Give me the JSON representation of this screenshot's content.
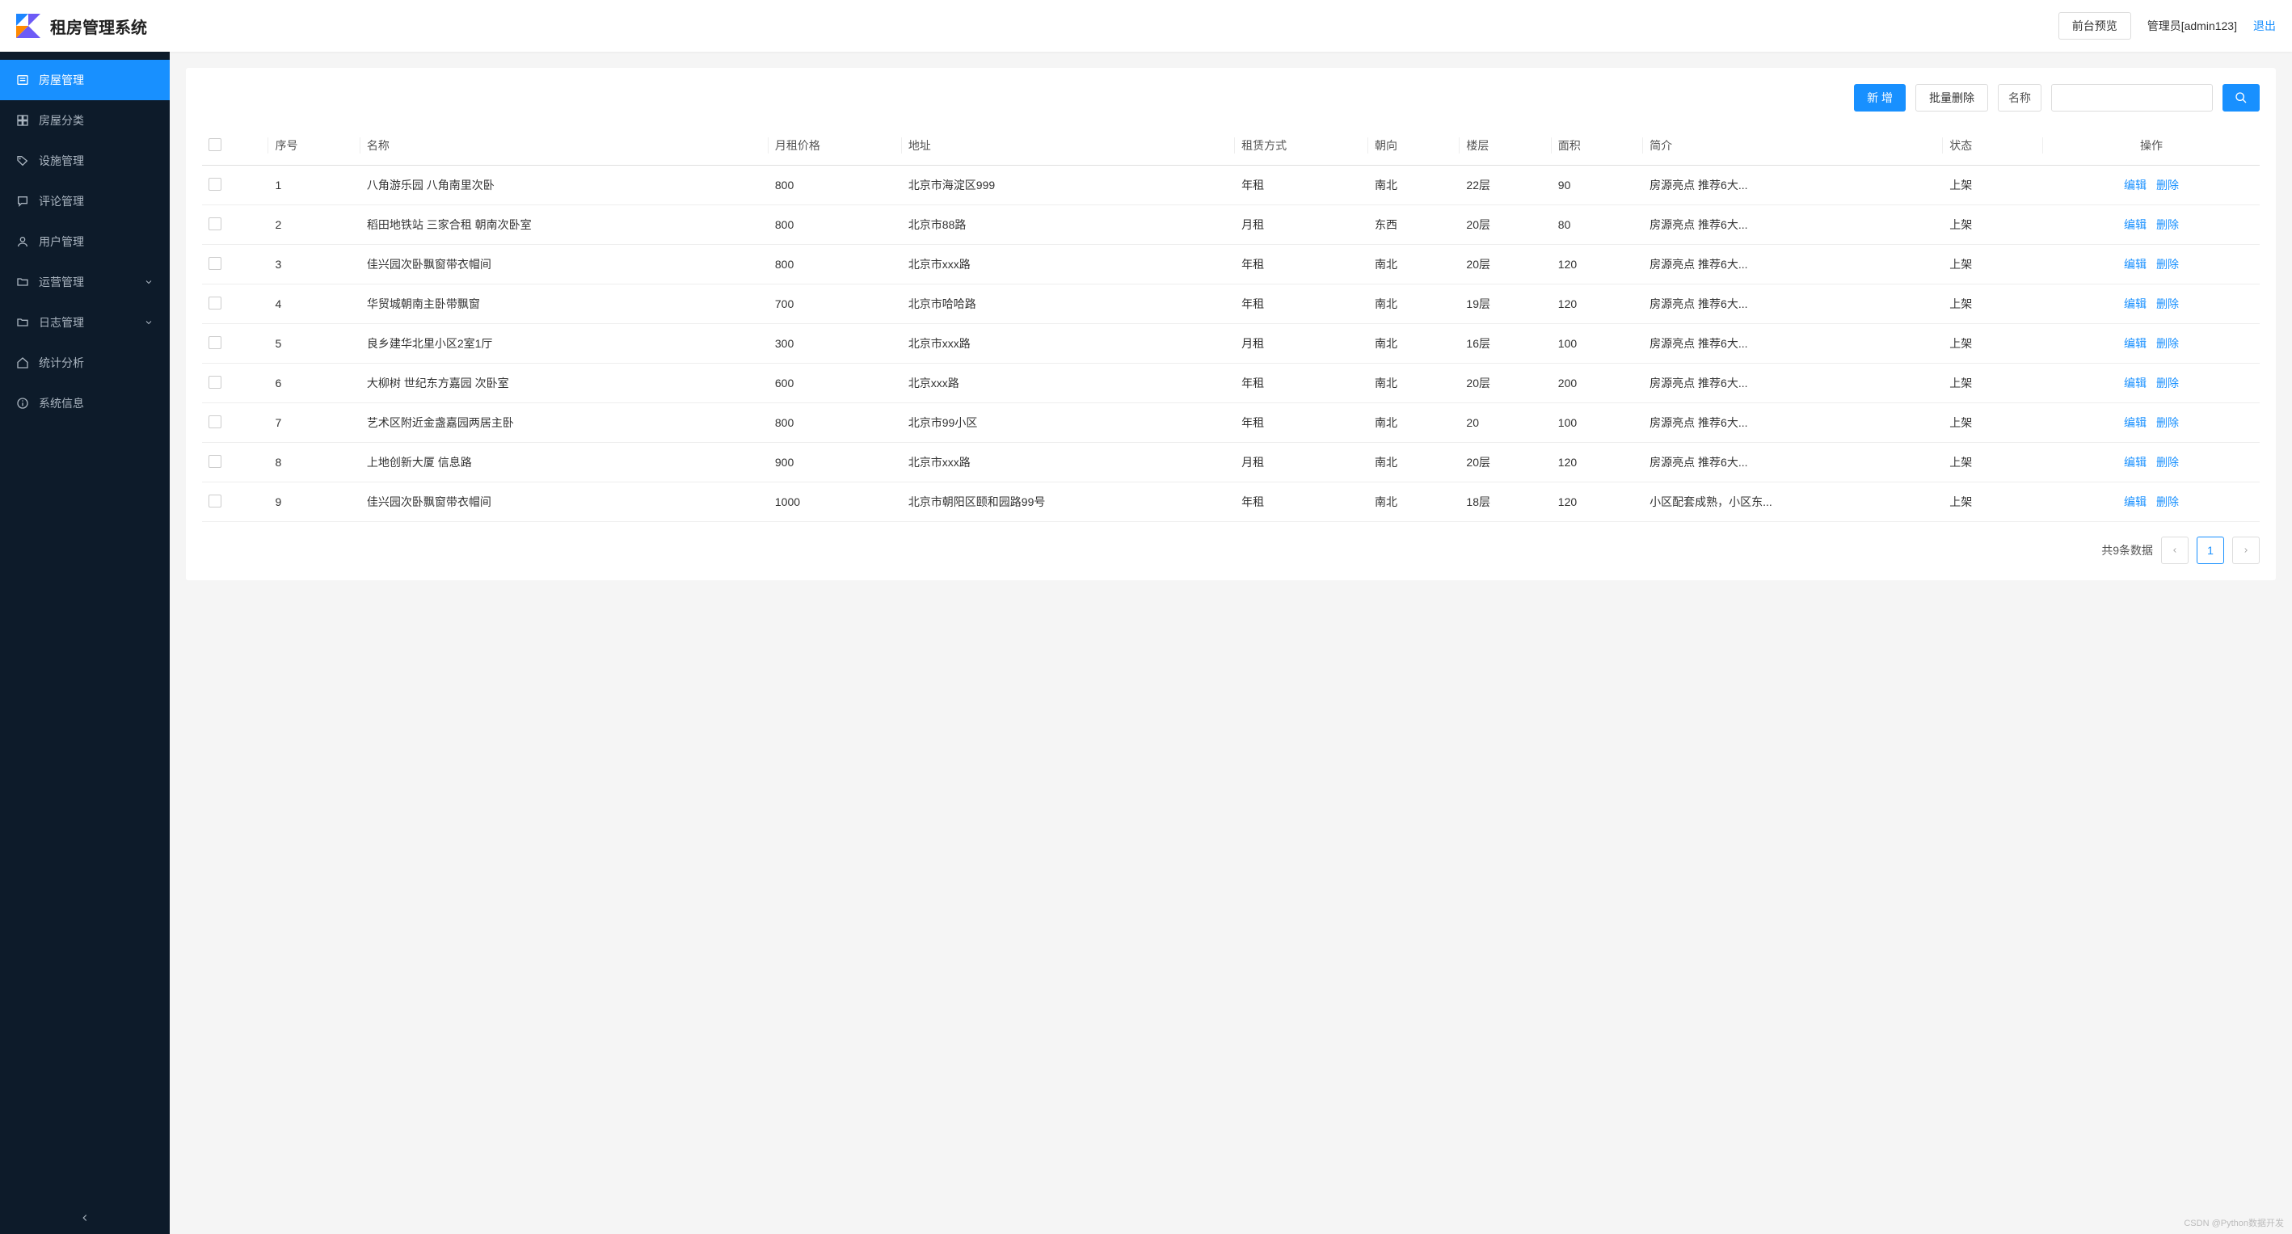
{
  "header": {
    "title": "租房管理系统",
    "preview_btn": "前台预览",
    "user_label": "管理员[admin123]",
    "logout_label": "退出"
  },
  "sidebar": {
    "items": [
      {
        "label": "房屋管理",
        "icon": "list",
        "active": true
      },
      {
        "label": "房屋分类",
        "icon": "grid"
      },
      {
        "label": "设施管理",
        "icon": "tag"
      },
      {
        "label": "评论管理",
        "icon": "chat"
      },
      {
        "label": "用户管理",
        "icon": "user"
      },
      {
        "label": "运营管理",
        "icon": "folder",
        "expandable": true
      },
      {
        "label": "日志管理",
        "icon": "folder",
        "expandable": true
      },
      {
        "label": "统计分析",
        "icon": "home"
      },
      {
        "label": "系统信息",
        "icon": "info"
      }
    ]
  },
  "toolbar": {
    "new_btn": "新 增",
    "batch_delete_btn": "批量删除",
    "search_field_label": "名称",
    "search_placeholder": ""
  },
  "table": {
    "columns": {
      "no": "序号",
      "name": "名称",
      "price": "月租价格",
      "addr": "地址",
      "rent": "租赁方式",
      "dir": "朝向",
      "floor": "楼层",
      "area": "面积",
      "intro": "简介",
      "status": "状态",
      "ops": "操作"
    },
    "ops": {
      "edit": "编辑",
      "delete": "删除"
    },
    "rows": [
      {
        "no": "1",
        "name": "八角游乐园 八角南里次卧",
        "price": "800",
        "addr": "北京市海淀区999",
        "rent": "年租",
        "dir": "南北",
        "floor": "22层",
        "area": "90",
        "intro": "房源亮点 推荐6大...",
        "status": "上架"
      },
      {
        "no": "2",
        "name": "稻田地铁站 三家合租 朝南次卧室",
        "price": "800",
        "addr": "北京市88路",
        "rent": "月租",
        "dir": "东西",
        "floor": "20层",
        "area": "80",
        "intro": "房源亮点 推荐6大...",
        "status": "上架"
      },
      {
        "no": "3",
        "name": "佳兴园次卧飘窗带衣帽间",
        "price": "800",
        "addr": "北京市xxx路",
        "rent": "年租",
        "dir": "南北",
        "floor": "20层",
        "area": "120",
        "intro": "房源亮点 推荐6大...",
        "status": "上架"
      },
      {
        "no": "4",
        "name": "华贸城朝南主卧带飘窗",
        "price": "700",
        "addr": "北京市哈哈路",
        "rent": "年租",
        "dir": "南北",
        "floor": "19层",
        "area": "120",
        "intro": "房源亮点 推荐6大...",
        "status": "上架"
      },
      {
        "no": "5",
        "name": "良乡建华北里小区2室1厅",
        "price": "300",
        "addr": "北京市xxx路",
        "rent": "月租",
        "dir": "南北",
        "floor": "16层",
        "area": "100",
        "intro": "房源亮点 推荐6大...",
        "status": "上架"
      },
      {
        "no": "6",
        "name": "大柳树 世纪东方嘉园 次卧室",
        "price": "600",
        "addr": "北京xxx路",
        "rent": "年租",
        "dir": "南北",
        "floor": "20层",
        "area": "200",
        "intro": "房源亮点 推荐6大...",
        "status": "上架"
      },
      {
        "no": "7",
        "name": "艺术区附近金盏嘉园两居主卧",
        "price": "800",
        "addr": "北京市99小区",
        "rent": "年租",
        "dir": "南北",
        "floor": "20",
        "area": "100",
        "intro": "房源亮点 推荐6大...",
        "status": "上架"
      },
      {
        "no": "8",
        "name": "上地创新大厦 信息路",
        "price": "900",
        "addr": "北京市xxx路",
        "rent": "月租",
        "dir": "南北",
        "floor": "20层",
        "area": "120",
        "intro": "房源亮点 推荐6大...",
        "status": "上架"
      },
      {
        "no": "9",
        "name": "佳兴园次卧飘窗带衣帽间",
        "price": "1000",
        "addr": "北京市朝阳区颐和园路99号",
        "rent": "年租",
        "dir": "南北",
        "floor": "18层",
        "area": "120",
        "intro": "小区配套成熟，小区东...",
        "status": "上架"
      }
    ]
  },
  "pagination": {
    "total_text": "共9条数据",
    "current": "1"
  },
  "watermark": "CSDN @Python数据开发"
}
